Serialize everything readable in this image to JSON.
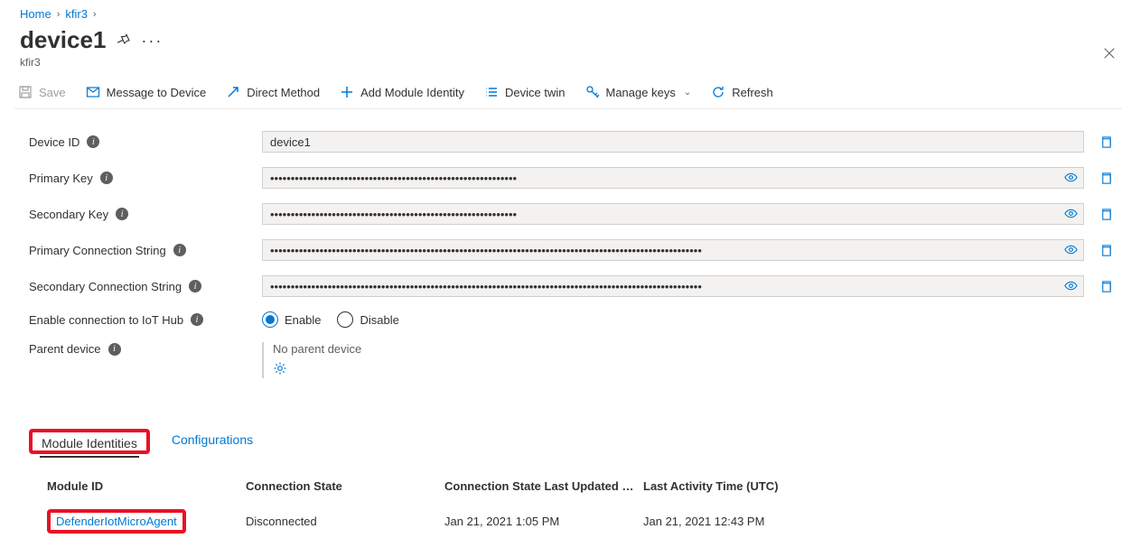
{
  "breadcrumb": {
    "home": "Home",
    "hub": "kfir3"
  },
  "header": {
    "title": "device1",
    "sub": "kfir3"
  },
  "toolbar": {
    "save": "Save",
    "message": "Message to Device",
    "direct": "Direct Method",
    "addModule": "Add Module Identity",
    "twin": "Device twin",
    "keys": "Manage keys",
    "refresh": "Refresh"
  },
  "fields": {
    "deviceIdLabel": "Device ID",
    "deviceId": "device1",
    "primaryKeyLabel": "Primary Key",
    "primaryKey": "••••••••••••••••••••••••••••••••••••••••••••••••••••••••••••",
    "secondaryKeyLabel": "Secondary Key",
    "secondaryKey": "••••••••••••••••••••••••••••••••••••••••••••••••••••••••••••",
    "primaryConnLabel": "Primary Connection String",
    "primaryConn": "•••••••••••••••••••••••••••••••••••••••••••••••••••••••••••••••••••••••••••••••••••••••••••••••••••••••••",
    "secondaryConnLabel": "Secondary Connection String",
    "secondaryConn": "•••••••••••••••••••••••••••••••••••••••••••••••••••••••••••••••••••••••••••••••••••••••••••••••••••••••••",
    "enableLabel": "Enable connection to IoT Hub",
    "enable": "Enable",
    "disable": "Disable",
    "parentLabel": "Parent device",
    "noParent": "No parent device"
  },
  "tabs": {
    "modules": "Module Identities",
    "configs": "Configurations"
  },
  "table": {
    "hModuleId": "Module ID",
    "hConnState": "Connection State",
    "hConnUpdated": "Connection State Last Updated …",
    "hLastActivity": "Last Activity Time (UTC)",
    "rows": [
      {
        "moduleId": "DefenderIotMicroAgent",
        "connState": "Disconnected",
        "connUpdated": "Jan 21, 2021 1:05 PM",
        "lastActivity": "Jan 21, 2021 12:43 PM"
      }
    ]
  }
}
